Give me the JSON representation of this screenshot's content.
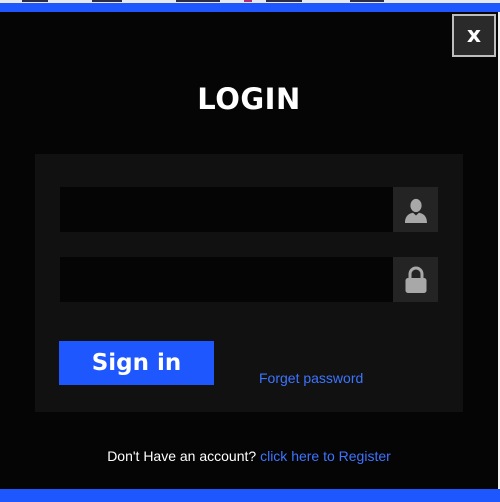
{
  "modal": {
    "close_label": "x",
    "title": "LOGIN"
  },
  "form": {
    "username": {
      "value": "",
      "placeholder": "",
      "icon": "user-icon"
    },
    "password": {
      "value": "",
      "placeholder": "",
      "icon": "lock-icon"
    },
    "signin_label": "Sign in",
    "forget_label": "Forget password"
  },
  "footer": {
    "prompt": "Don't Have an account?",
    "register_label": "click here to Register"
  },
  "colors": {
    "accent": "#1f57ff",
    "link": "#3d74ff",
    "modal_background": "#050505",
    "panel_background": "#111111"
  }
}
